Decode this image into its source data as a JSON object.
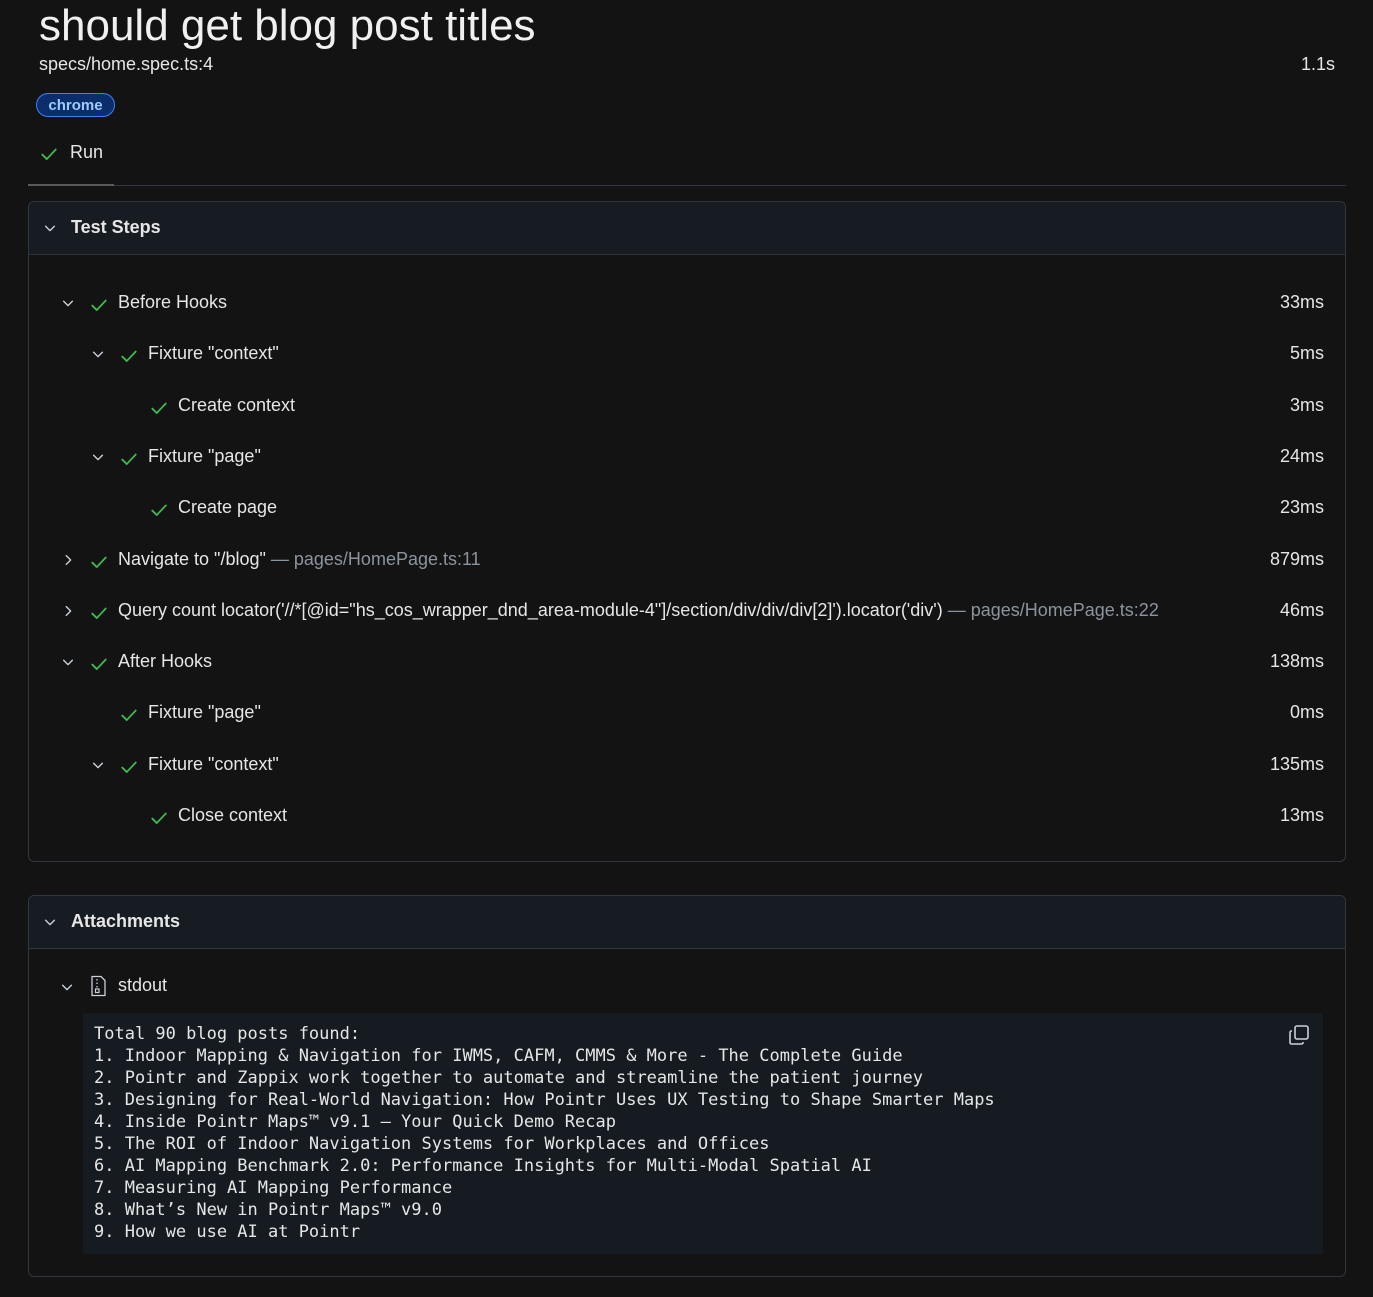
{
  "header": {
    "title": "should get blog post titles",
    "spec_path": "specs/home.spec.ts:4",
    "duration": "1.1s",
    "project_badge": "chrome"
  },
  "tabs": [
    {
      "label": "Run",
      "status": "passed"
    }
  ],
  "test_steps": {
    "title": "Test Steps",
    "steps": [
      {
        "title": "Before Hooks",
        "location": "",
        "duration": "33ms",
        "depth": 0,
        "expandable": true,
        "expanded": true
      },
      {
        "title": "Fixture \"context\"",
        "location": "",
        "duration": "5ms",
        "depth": 1,
        "expandable": true,
        "expanded": true
      },
      {
        "title": "Create context",
        "location": "",
        "duration": "3ms",
        "depth": 2,
        "expandable": false,
        "expanded": false
      },
      {
        "title": "Fixture \"page\"",
        "location": "",
        "duration": "24ms",
        "depth": 1,
        "expandable": true,
        "expanded": true
      },
      {
        "title": "Create page",
        "location": "",
        "duration": "23ms",
        "depth": 2,
        "expandable": false,
        "expanded": false
      },
      {
        "title": "Navigate to \"/blog\"",
        "location": "— pages/HomePage.ts:11",
        "duration": "879ms",
        "depth": 0,
        "expandable": true,
        "expanded": false
      },
      {
        "title": "Query count locator('//*[@id=\"hs_cos_wrapper_dnd_area-module-4\"]/section/div/div/div[2]').locator('div')",
        "location": "— pages/HomePage.ts:22",
        "duration": "46ms",
        "depth": 0,
        "expandable": true,
        "expanded": false
      },
      {
        "title": "After Hooks",
        "location": "",
        "duration": "138ms",
        "depth": 0,
        "expandable": true,
        "expanded": true
      },
      {
        "title": "Fixture \"page\"",
        "location": "",
        "duration": "0ms",
        "depth": 1,
        "expandable": false,
        "expanded": false
      },
      {
        "title": "Fixture \"context\"",
        "location": "",
        "duration": "135ms",
        "depth": 1,
        "expandable": true,
        "expanded": true
      },
      {
        "title": "Close context",
        "location": "",
        "duration": "13ms",
        "depth": 2,
        "expandable": false,
        "expanded": false
      }
    ]
  },
  "attachments": {
    "title": "Attachments",
    "items": [
      {
        "name": "stdout",
        "lines": [
          "Total 90 blog posts found:",
          "1. Indoor Mapping & Navigation for IWMS, CAFM, CMMS & More - The Complete Guide",
          "2. Pointr and Zappix work together to automate and streamline the patient journey",
          "3. Designing for Real-World Navigation: How Pointr Uses UX Testing to Shape Smarter Maps",
          "4. Inside Pointr Maps™ v9.1 — Your Quick Demo Recap",
          "5. The ROI of Indoor Navigation Systems for Workplaces and Offices",
          "6. AI Mapping Benchmark 2.0: Performance Insights for Multi-Modal Spatial AI",
          "7. Measuring AI Mapping Performance",
          "8. What’s New in Pointr Maps™ v9.0",
          "9. How we use AI at Pointr"
        ]
      }
    ]
  },
  "colors": {
    "background": "#131313",
    "success": "#3fb950",
    "badge_border": "#3b82f6",
    "badge_text": "#9ecbff",
    "muted": "#8b949e"
  },
  "icons": {
    "status": "check-icon",
    "toggle_open": "chevron-down-icon",
    "toggle_closed": "chevron-right-icon",
    "attachment": "file-icon",
    "copy": "copy-icon"
  }
}
